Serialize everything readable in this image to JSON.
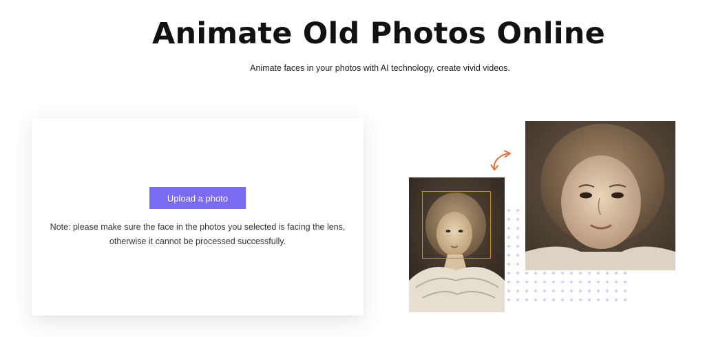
{
  "hero": {
    "title": "Animate Old Photos Online",
    "subtitle": "Animate faces in your photos with AI technology, create vivid videos."
  },
  "upload": {
    "button_label": "Upload a photo",
    "note": "Note: please make sure the face in the photos you selected is facing the lens, otherwise it cannot be processed successfully."
  },
  "illustration": {
    "small_photo_icon": "vintage-portrait-photo",
    "large_photo_icon": "animated-portrait-photo",
    "arrow_icon": "curved-arrow-icon",
    "arrow_color": "#e0733a",
    "dots_color": "#b8b4f0"
  },
  "colors": {
    "accent": "#7b6cf6"
  }
}
